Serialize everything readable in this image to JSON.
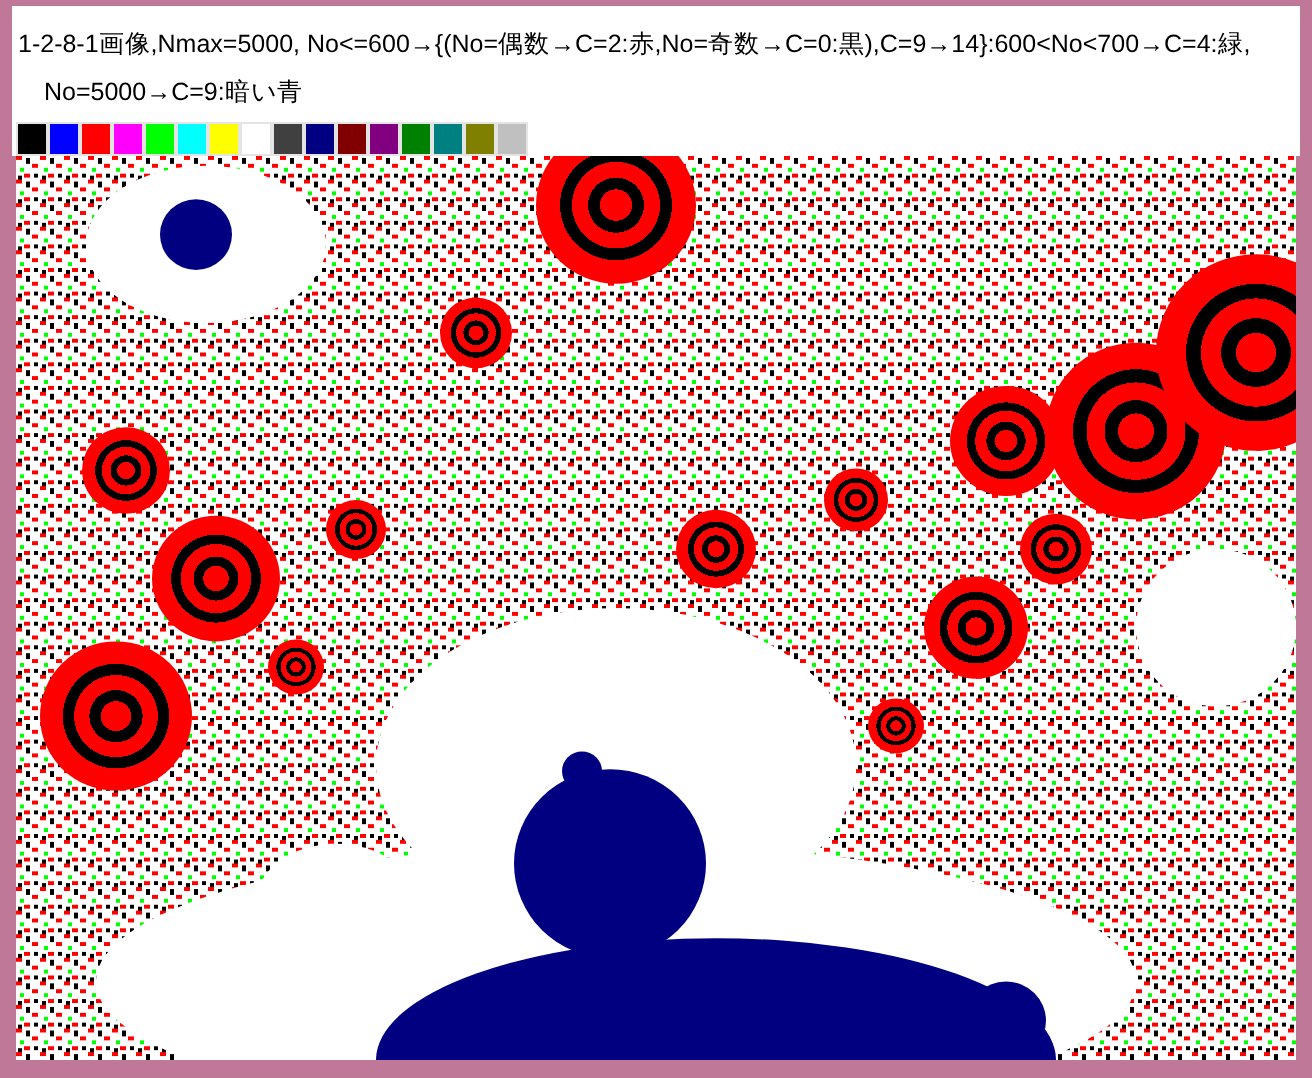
{
  "caption": "1-2-8-1画像,Nmax=5000, No<=600→{(No=偶数→C=2:赤,No=奇数→C=0:黒),C=9→14}:600<No<700→C=4:緑, No=5000→C=9:暗い青",
  "palette": [
    {
      "color": "#000000"
    },
    {
      "color": "#0000ff"
    },
    {
      "color": "#ff0000"
    },
    {
      "color": "#ff00ff"
    },
    {
      "color": "#00ff00"
    },
    {
      "color": "#00ffff"
    },
    {
      "color": "#ffff00"
    },
    {
      "color": "#ffffff"
    },
    {
      "color": "#404040"
    },
    {
      "color": "#000080"
    },
    {
      "color": "#800000"
    },
    {
      "color": "#800080"
    },
    {
      "color": "#008000"
    },
    {
      "color": "#008080"
    },
    {
      "color": "#808000"
    },
    {
      "color": "#c0c0c0"
    }
  ]
}
